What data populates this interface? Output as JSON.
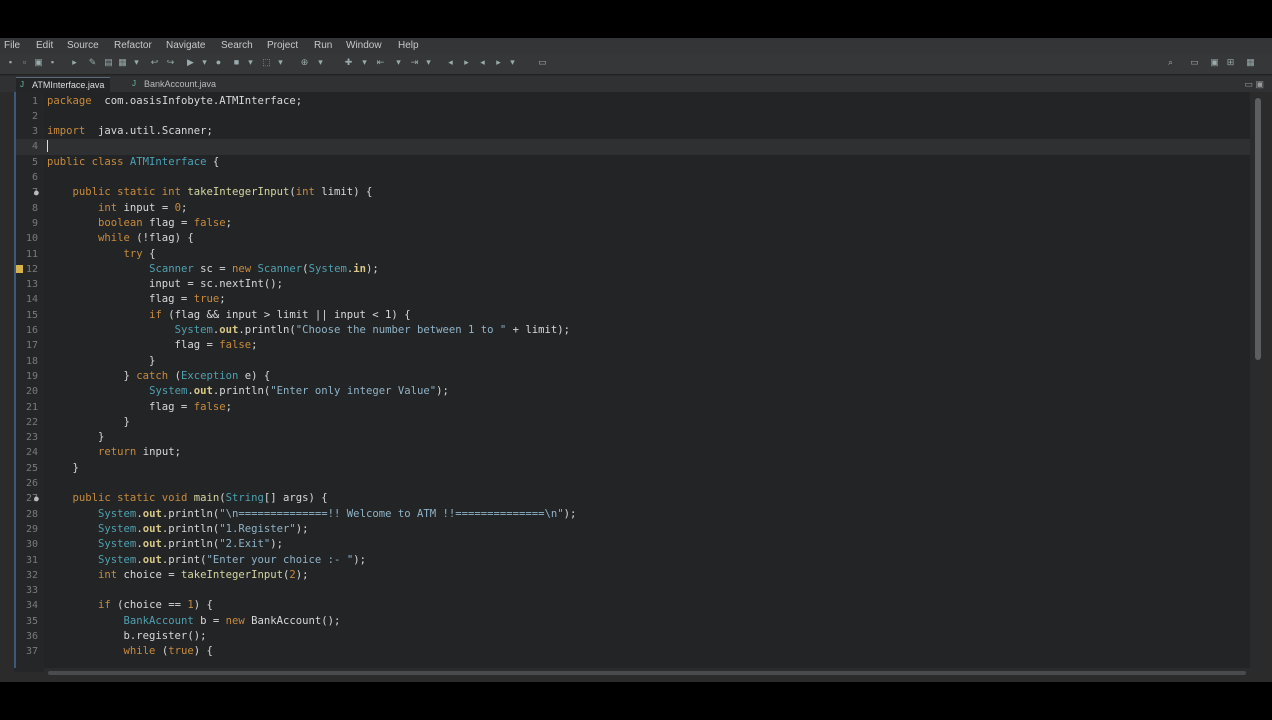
{
  "menu": [
    "File",
    "Edit",
    "Source",
    "Refactor",
    "Navigate",
    "Search",
    "Project",
    "Run",
    "Window",
    "Help"
  ],
  "tabs": [
    {
      "label": "ATMInterface.java",
      "active": true
    },
    {
      "label": "BankAccount.java",
      "active": false
    }
  ],
  "code": [
    {
      "n": "1",
      "segs": [
        [
          "kw",
          "package"
        ],
        [
          "",
          "  com.oasisInfobyte.ATMInterface;"
        ]
      ]
    },
    {
      "n": "2",
      "segs": []
    },
    {
      "n": "3",
      "segs": [
        [
          "kw",
          "import"
        ],
        [
          "",
          "  java.util.Scanner;"
        ]
      ]
    },
    {
      "n": "4",
      "segs": [],
      "cursor": true
    },
    {
      "n": "5",
      "segs": [
        [
          "kw",
          "public class "
        ],
        [
          "cls",
          "ATMInterface"
        ],
        [
          "",
          " {"
        ]
      ]
    },
    {
      "n": "6",
      "segs": []
    },
    {
      "n": "7",
      "segs": [
        [
          "",
          "    "
        ],
        [
          "kw",
          "public static int "
        ],
        [
          "fn",
          "takeIntegerInput"
        ],
        [
          "",
          "("
        ],
        [
          "kw",
          "int"
        ],
        [
          "",
          " limit) {"
        ]
      ],
      "marker": "○●"
    },
    {
      "n": "8",
      "segs": [
        [
          "",
          "        "
        ],
        [
          "kw",
          "int"
        ],
        [
          "",
          " input = "
        ],
        [
          "kw",
          "0"
        ],
        [
          "",
          ";"
        ]
      ]
    },
    {
      "n": "9",
      "segs": [
        [
          "",
          "        "
        ],
        [
          "kw",
          "boolean"
        ],
        [
          "",
          " flag = "
        ],
        [
          "kw",
          "false"
        ],
        [
          "",
          ";"
        ]
      ]
    },
    {
      "n": "10",
      "segs": [
        [
          "",
          "        "
        ],
        [
          "kw",
          "while"
        ],
        [
          "",
          " (!flag) {"
        ]
      ]
    },
    {
      "n": "11",
      "segs": [
        [
          "",
          "            "
        ],
        [
          "kw",
          "try"
        ],
        [
          "",
          " {"
        ]
      ]
    },
    {
      "n": "12",
      "segs": [
        [
          "",
          "                "
        ],
        [
          "ty",
          "Scanner"
        ],
        [
          "",
          " sc = "
        ],
        [
          "kw",
          "new "
        ],
        [
          "ty",
          "Scanner"
        ],
        [
          "",
          "("
        ],
        [
          "ty",
          "System"
        ],
        [
          "",
          "."
        ],
        [
          "fld",
          "in"
        ],
        [
          "",
          ");"
        ]
      ],
      "warn": true
    },
    {
      "n": "13",
      "segs": [
        [
          "",
          "                input = sc.nextInt();"
        ]
      ]
    },
    {
      "n": "14",
      "segs": [
        [
          "",
          "                flag = "
        ],
        [
          "kw",
          "true"
        ],
        [
          "",
          ";"
        ]
      ]
    },
    {
      "n": "15",
      "segs": [
        [
          "",
          "                "
        ],
        [
          "kw",
          "if"
        ],
        [
          "",
          " (flag && input > limit || input < 1) {"
        ]
      ]
    },
    {
      "n": "16",
      "segs": [
        [
          "",
          "                    "
        ],
        [
          "ty",
          "System"
        ],
        [
          "",
          "."
        ],
        [
          "fld",
          "out"
        ],
        [
          "",
          ".println("
        ],
        [
          "str",
          "\"Choose the number between 1 to \""
        ],
        [
          "",
          " + limit);"
        ]
      ]
    },
    {
      "n": "17",
      "segs": [
        [
          "",
          "                    flag = "
        ],
        [
          "kw",
          "false"
        ],
        [
          "",
          ";"
        ]
      ]
    },
    {
      "n": "18",
      "segs": [
        [
          "",
          "                }"
        ]
      ]
    },
    {
      "n": "19",
      "segs": [
        [
          "",
          "            } "
        ],
        [
          "kw",
          "catch"
        ],
        [
          "",
          " ("
        ],
        [
          "ty",
          "Exception"
        ],
        [
          "",
          " e) {"
        ]
      ]
    },
    {
      "n": "20",
      "segs": [
        [
          "",
          "                "
        ],
        [
          "ty",
          "System"
        ],
        [
          "",
          "."
        ],
        [
          "fld",
          "out"
        ],
        [
          "",
          ".println("
        ],
        [
          "str",
          "\"Enter only integer Value\""
        ],
        [
          "",
          ");"
        ]
      ]
    },
    {
      "n": "21",
      "segs": [
        [
          "",
          "                flag = "
        ],
        [
          "kw",
          "false"
        ],
        [
          "",
          ";"
        ]
      ]
    },
    {
      "n": "22",
      "segs": [
        [
          "",
          "            }"
        ]
      ]
    },
    {
      "n": "23",
      "segs": [
        [
          "",
          "        }"
        ]
      ]
    },
    {
      "n": "24",
      "segs": [
        [
          "",
          "        "
        ],
        [
          "kw",
          "return"
        ],
        [
          "",
          " input;"
        ]
      ]
    },
    {
      "n": "25",
      "segs": [
        [
          "",
          "    }"
        ]
      ]
    },
    {
      "n": "26",
      "segs": []
    },
    {
      "n": "27",
      "segs": [
        [
          "",
          "    "
        ],
        [
          "kw",
          "public static void "
        ],
        [
          "fn",
          "main"
        ],
        [
          "",
          "("
        ],
        [
          "ty",
          "String"
        ],
        [
          "",
          "[] args) {"
        ]
      ],
      "marker": "○●"
    },
    {
      "n": "28",
      "segs": [
        [
          "",
          "        "
        ],
        [
          "ty",
          "System"
        ],
        [
          "",
          "."
        ],
        [
          "fld",
          "out"
        ],
        [
          "",
          ".println("
        ],
        [
          "str",
          "\"\\n==============!! Welcome to ATM !!==============\\n\""
        ],
        [
          "",
          ");"
        ]
      ]
    },
    {
      "n": "29",
      "segs": [
        [
          "",
          "        "
        ],
        [
          "ty",
          "System"
        ],
        [
          "",
          "."
        ],
        [
          "fld",
          "out"
        ],
        [
          "",
          ".println("
        ],
        [
          "str",
          "\"1.Register\""
        ],
        [
          "",
          ");"
        ]
      ]
    },
    {
      "n": "30",
      "segs": [
        [
          "",
          "        "
        ],
        [
          "ty",
          "System"
        ],
        [
          "",
          "."
        ],
        [
          "fld",
          "out"
        ],
        [
          "",
          ".println("
        ],
        [
          "str",
          "\"2.Exit\""
        ],
        [
          "",
          ");"
        ]
      ]
    },
    {
      "n": "31",
      "segs": [
        [
          "",
          "        "
        ],
        [
          "ty",
          "System"
        ],
        [
          "",
          "."
        ],
        [
          "fld",
          "out"
        ],
        [
          "",
          ".print("
        ],
        [
          "str",
          "\"Enter your choice :- \""
        ],
        [
          "",
          ");"
        ]
      ]
    },
    {
      "n": "32",
      "segs": [
        [
          "",
          "        "
        ],
        [
          "kw",
          "int"
        ],
        [
          "",
          " choice = "
        ],
        [
          "fn",
          "takeIntegerInput"
        ],
        [
          "",
          "("
        ],
        [
          "kw",
          "2"
        ],
        [
          "",
          ");"
        ]
      ]
    },
    {
      "n": "33",
      "segs": []
    },
    {
      "n": "34",
      "segs": [
        [
          "",
          "        "
        ],
        [
          "kw",
          "if"
        ],
        [
          "",
          " (choice == "
        ],
        [
          "kw",
          "1"
        ],
        [
          "",
          ") {"
        ]
      ]
    },
    {
      "n": "35",
      "segs": [
        [
          "",
          "            "
        ],
        [
          "ty",
          "BankAccount"
        ],
        [
          "",
          " b = "
        ],
        [
          "kw",
          "new "
        ],
        [
          "",
          "BankAccount();"
        ]
      ]
    },
    {
      "n": "36",
      "segs": [
        [
          "",
          "            b.register();"
        ]
      ]
    },
    {
      "n": "37",
      "segs": [
        [
          "",
          "            "
        ],
        [
          "kw",
          "while"
        ],
        [
          "",
          " ("
        ],
        [
          "kw",
          "true"
        ],
        [
          "",
          ") {"
        ]
      ]
    }
  ]
}
